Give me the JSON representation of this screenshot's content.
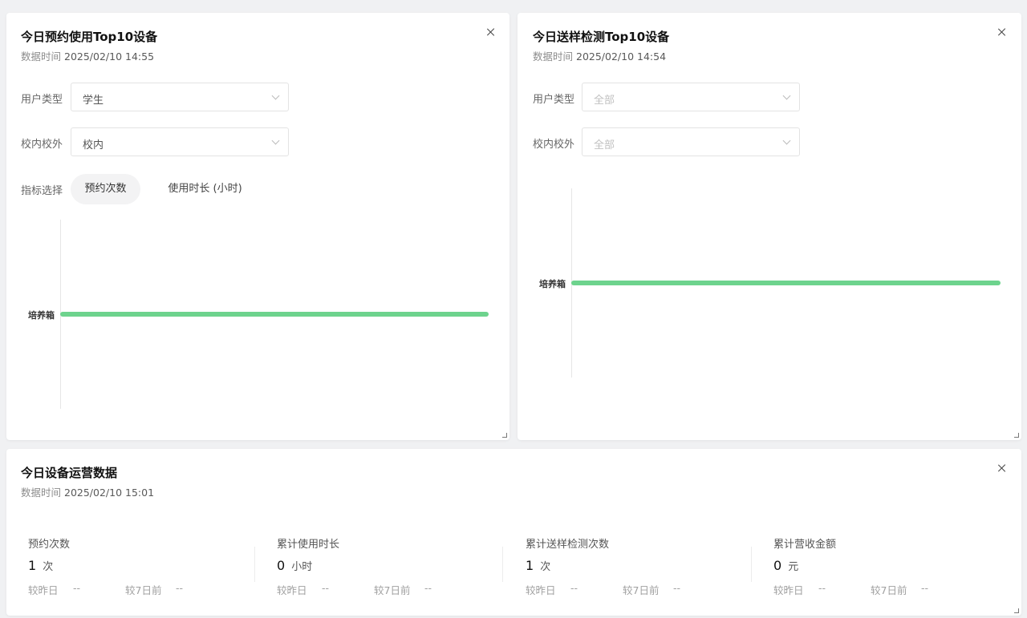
{
  "colors": {
    "bar": "#6dd38d",
    "accent": "#111111"
  },
  "panel_reservation": {
    "title": "今日预约使用Top10设备",
    "time_label": "数据时间",
    "time_value": "2025/02/10 14:55",
    "user_type_label": "用户类型",
    "user_type_value": "学生",
    "campus_label": "校内校外",
    "campus_value": "校内",
    "metric_label": "指标选择",
    "metric_tabs": [
      "预约次数",
      "使用时长 (小时)"
    ],
    "metric_selected": "预约次数",
    "chart_data": {
      "type": "bar",
      "orientation": "horizontal",
      "categories": [
        "培养箱"
      ],
      "values": [
        1
      ],
      "xlim": [
        0,
        1
      ]
    }
  },
  "panel_sample": {
    "title": "今日送样检测Top10设备",
    "time_label": "数据时间",
    "time_value": "2025/02/10 14:54",
    "user_type_label": "用户类型",
    "user_type_placeholder": "全部",
    "campus_label": "校内校外",
    "campus_placeholder": "全部",
    "chart_data": {
      "type": "bar",
      "orientation": "horizontal",
      "categories": [
        "培养箱"
      ],
      "values": [
        1
      ],
      "xlim": [
        0,
        1
      ]
    }
  },
  "panel_ops": {
    "title": "今日设备运营数据",
    "time_label": "数据时间",
    "time_value": "2025/02/10 15:01",
    "stats": [
      {
        "label": "预约次数",
        "value": "1",
        "unit": "次",
        "cmp_day_label": "较昨日",
        "cmp_day_value": "--",
        "cmp_week_label": "较7日前",
        "cmp_week_value": "--"
      },
      {
        "label": "累计使用时长",
        "value": "0",
        "unit": "小时",
        "cmp_day_label": "较昨日",
        "cmp_day_value": "--",
        "cmp_week_label": "较7日前",
        "cmp_week_value": "--"
      },
      {
        "label": "累计送样检测次数",
        "value": "1",
        "unit": "次",
        "cmp_day_label": "较昨日",
        "cmp_day_value": "--",
        "cmp_week_label": "较7日前",
        "cmp_week_value": "--"
      },
      {
        "label": "累计营收金额",
        "value": "0",
        "unit": "元",
        "cmp_day_label": "较昨日",
        "cmp_day_value": "--",
        "cmp_week_label": "较7日前",
        "cmp_week_value": "--"
      }
    ]
  }
}
